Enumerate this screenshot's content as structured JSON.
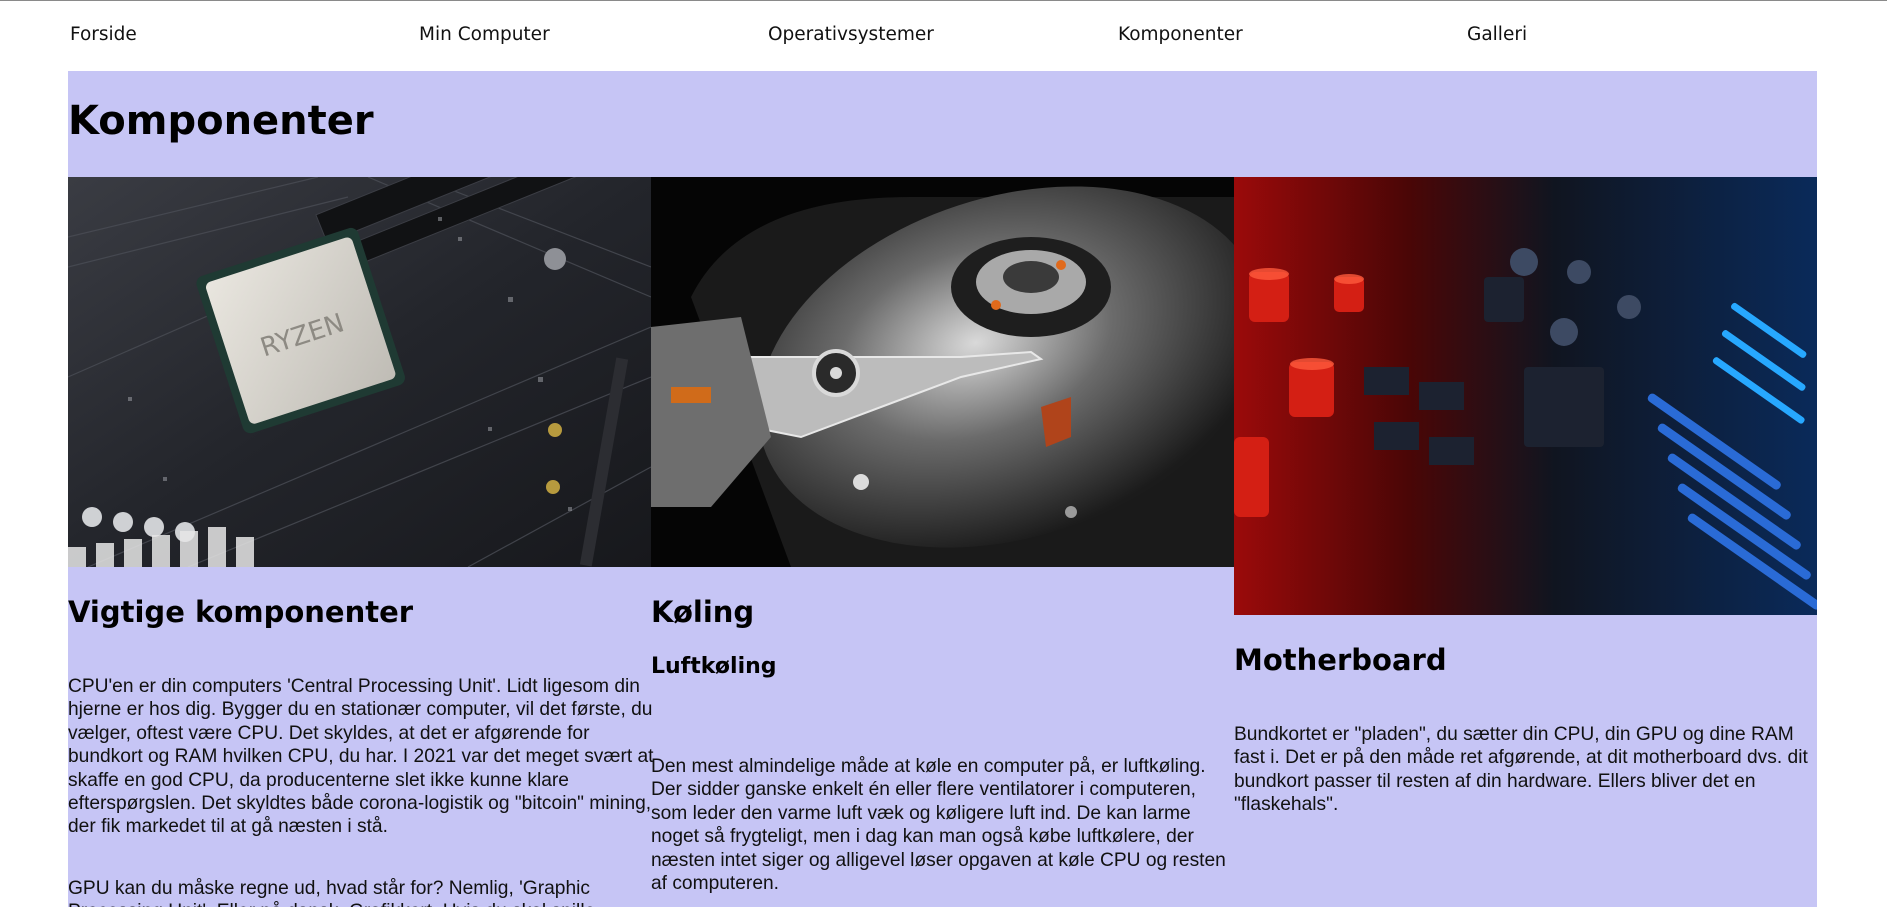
{
  "nav": {
    "items": [
      {
        "label": "Forside"
      },
      {
        "label": "Min Computer"
      },
      {
        "label": "Operativsystemer"
      },
      {
        "label": "Komponenter"
      },
      {
        "label": "Galleri"
      }
    ]
  },
  "page": {
    "title": "Komponenter"
  },
  "columns": [
    {
      "image": "ryzen-cpu-on-motherboard-photo",
      "heading": "Vigtige komponenter",
      "paragraphs": [
        "CPU'en er din computers 'Central Processing Unit'. Lidt ligesom din hjerne er hos dig. Bygger du en stationær computer, vil det første, du vælger, oftest være CPU. Det skyldes, at det er afgørende for bundkort og RAM hvilken CPU, du har. I 2021 var det meget svært at skaffe en god CPU, da producenterne slet ikke kunne klare efterspørgslen. Det skyldtes både corona-logistik og \"bitcoin\" mining, der fik markedet til at gå næsten i stå.",
        "GPU kan du måske regne ud, hvad står for? Nemlig, 'Graphic Processing Unit'. Eller på dansk, Grafikkort. Hvis du skal spille"
      ]
    },
    {
      "image": "open-hard-drive-photo",
      "heading": "Køling",
      "subheading": "Luftkøling",
      "paragraphs": [
        "Den mest almindelige måde at køle en computer på, er luftkøling. Der sidder ganske enkelt én eller flere ventilatorer i computeren, som leder den varme luft væk og køligere luft ind. De kan larme noget så frygteligt, men i dag kan man også købe luftkølere, der næsten intet siger og alligevel løser opgaven at køle CPU og resten af computeren."
      ]
    },
    {
      "image": "red-blue-lit-circuit-board-photo",
      "heading": "Motherboard",
      "paragraphs": [
        "Bundkortet er \"pladen\", du sætter din CPU, din GPU og dine RAM fast i. Det er på den måde ret afgørende, at dit motherboard dvs. dit bundkort passer til resten af din hardware. Ellers bliver det en \"flaskehals\"."
      ]
    }
  ],
  "colors": {
    "panel_background": "#c6c5f5",
    "page_background": "#ffffff",
    "text": "#111111"
  }
}
